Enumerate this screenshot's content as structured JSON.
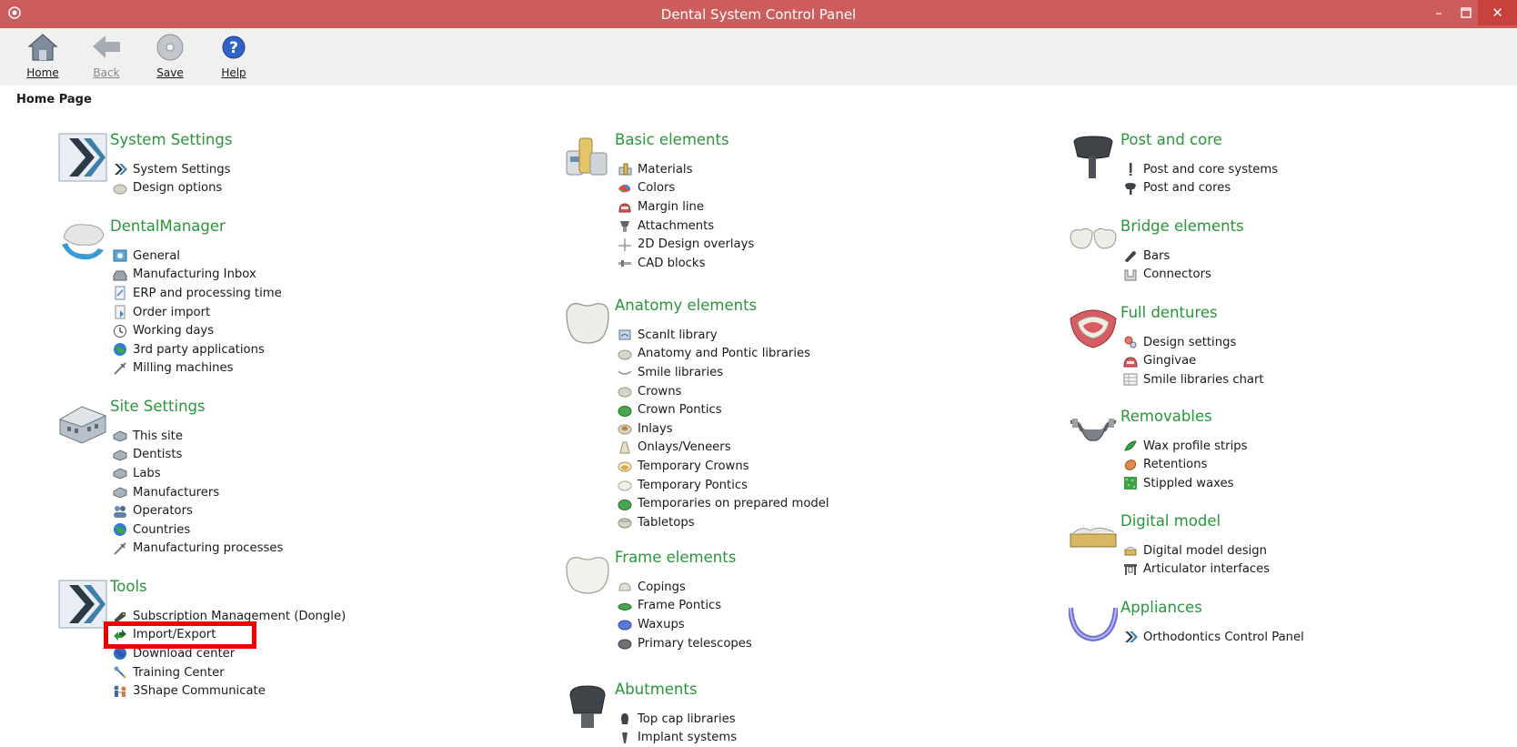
{
  "window": {
    "title": "Dental System Control Panel",
    "minimize": "–",
    "maximize": "□",
    "close": "✕"
  },
  "toolbar": {
    "home": "Home",
    "back": "Back",
    "save": "Save",
    "help": "Help"
  },
  "page_title": "Home Page",
  "sections": {
    "system_settings": {
      "title": "System Settings",
      "items": [
        "System Settings",
        "Design options"
      ]
    },
    "dental_manager": {
      "title": "DentalManager",
      "items": [
        "General",
        "Manufacturing Inbox",
        "ERP and processing time",
        "Order import",
        "Working days",
        "3rd party applications",
        "Milling machines"
      ]
    },
    "site_settings": {
      "title": "Site Settings",
      "items": [
        "This site",
        "Dentists",
        "Labs",
        "Manufacturers",
        "Operators",
        "Countries",
        "Manufacturing processes"
      ]
    },
    "tools": {
      "title": "Tools",
      "items": [
        "Subscription Management (Dongle)",
        "Import/Export",
        "Download center",
        "Training Center",
        "3Shape Communicate"
      ]
    },
    "basic_elements": {
      "title": "Basic elements",
      "items": [
        "Materials",
        "Colors",
        "Margin line",
        "Attachments",
        "2D Design overlays",
        "CAD blocks"
      ]
    },
    "anatomy_elements": {
      "title": "Anatomy elements",
      "items": [
        "ScanIt library",
        "Anatomy and Pontic libraries",
        "Smile libraries",
        "Crowns",
        "Crown Pontics",
        "Inlays",
        "Onlays/Veneers",
        "Temporary Crowns",
        "Temporary Pontics",
        "Temporaries on prepared model",
        "Tabletops"
      ]
    },
    "frame_elements": {
      "title": "Frame elements",
      "items": [
        "Copings",
        "Frame Pontics",
        "Waxups",
        "Primary telescopes"
      ]
    },
    "abutments": {
      "title": "Abutments",
      "items": [
        "Top cap libraries",
        "Implant systems"
      ]
    },
    "post_and_core": {
      "title": "Post and core",
      "items": [
        "Post and core systems",
        "Post and cores"
      ]
    },
    "bridge_elements": {
      "title": "Bridge elements",
      "items": [
        "Bars",
        "Connectors"
      ]
    },
    "full_dentures": {
      "title": "Full dentures",
      "items": [
        "Design settings",
        "Gingivae",
        "Smile libraries chart"
      ]
    },
    "removables": {
      "title": "Removables",
      "items": [
        "Wax profile strips",
        "Retentions",
        "Stippled waxes"
      ]
    },
    "digital_model": {
      "title": "Digital model",
      "items": [
        "Digital model design",
        "Articulator interfaces"
      ]
    },
    "appliances": {
      "title": "Appliances",
      "items": [
        "Orthodontics Control Panel"
      ]
    }
  },
  "colors": {
    "titlebar": "#cd5d5d",
    "section_heading": "#29963a",
    "highlight": "#ee0000"
  }
}
